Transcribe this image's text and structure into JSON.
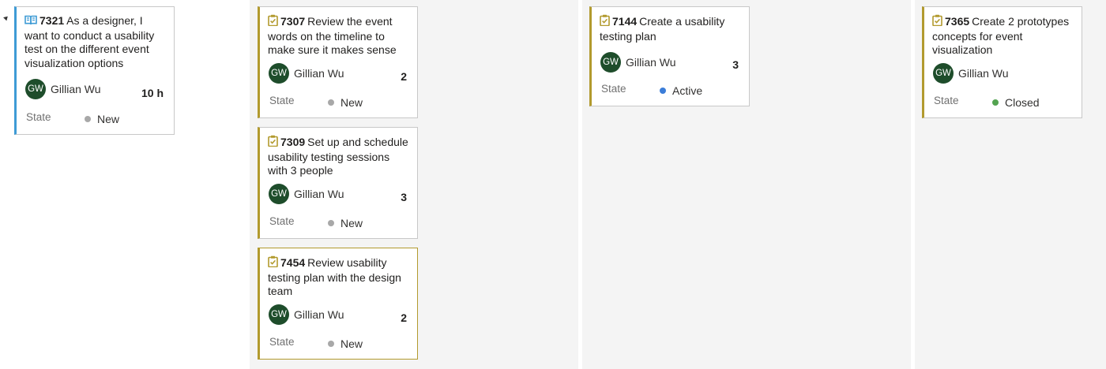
{
  "colors": {
    "story_accent": "#3e9bd5",
    "task_accent": "#b29a2e",
    "avatar_bg": "#1e4d2b",
    "state_new": "#a8a8a8",
    "state_active": "#3b7dd8",
    "state_closed": "#53a350"
  },
  "story": {
    "icon": "book-icon",
    "id": "7321",
    "title": "As a designer, I want to conduct a usability test on the different event visualization options",
    "assignee_initials": "GW",
    "assignee_name": "Gillian Wu",
    "effort": "10 h",
    "state_label": "State",
    "state": "New"
  },
  "tasks": {
    "t7307": {
      "icon": "clipboard-task-icon",
      "id": "7307",
      "title": "Review the event words on the timeline to make sure it makes sense",
      "assignee_initials": "GW",
      "assignee_name": "Gillian Wu",
      "effort": "2",
      "state_label": "State",
      "state": "New"
    },
    "t7309": {
      "icon": "clipboard-task-icon",
      "id": "7309",
      "title": "Set up and schedule usability testing sessions with 3 people",
      "assignee_initials": "GW",
      "assignee_name": "Gillian Wu",
      "effort": "3",
      "state_label": "State",
      "state": "New"
    },
    "t7454": {
      "icon": "clipboard-task-icon",
      "id": "7454",
      "title": "Review usability testing plan with the design team",
      "assignee_initials": "GW",
      "assignee_name": "Gillian Wu",
      "effort": "2",
      "state_label": "State",
      "state": "New"
    },
    "t7144": {
      "icon": "clipboard-task-icon",
      "id": "7144",
      "title": "Create a usability testing plan",
      "assignee_initials": "GW",
      "assignee_name": "Gillian Wu",
      "effort": "3",
      "state_label": "State",
      "state": "Active"
    },
    "t7365": {
      "icon": "clipboard-task-icon",
      "id": "7365",
      "title": "Create 2 prototypes concepts for event visualization",
      "assignee_initials": "GW",
      "assignee_name": "Gillian Wu",
      "effort": "",
      "state_label": "State",
      "state": "Closed"
    }
  }
}
